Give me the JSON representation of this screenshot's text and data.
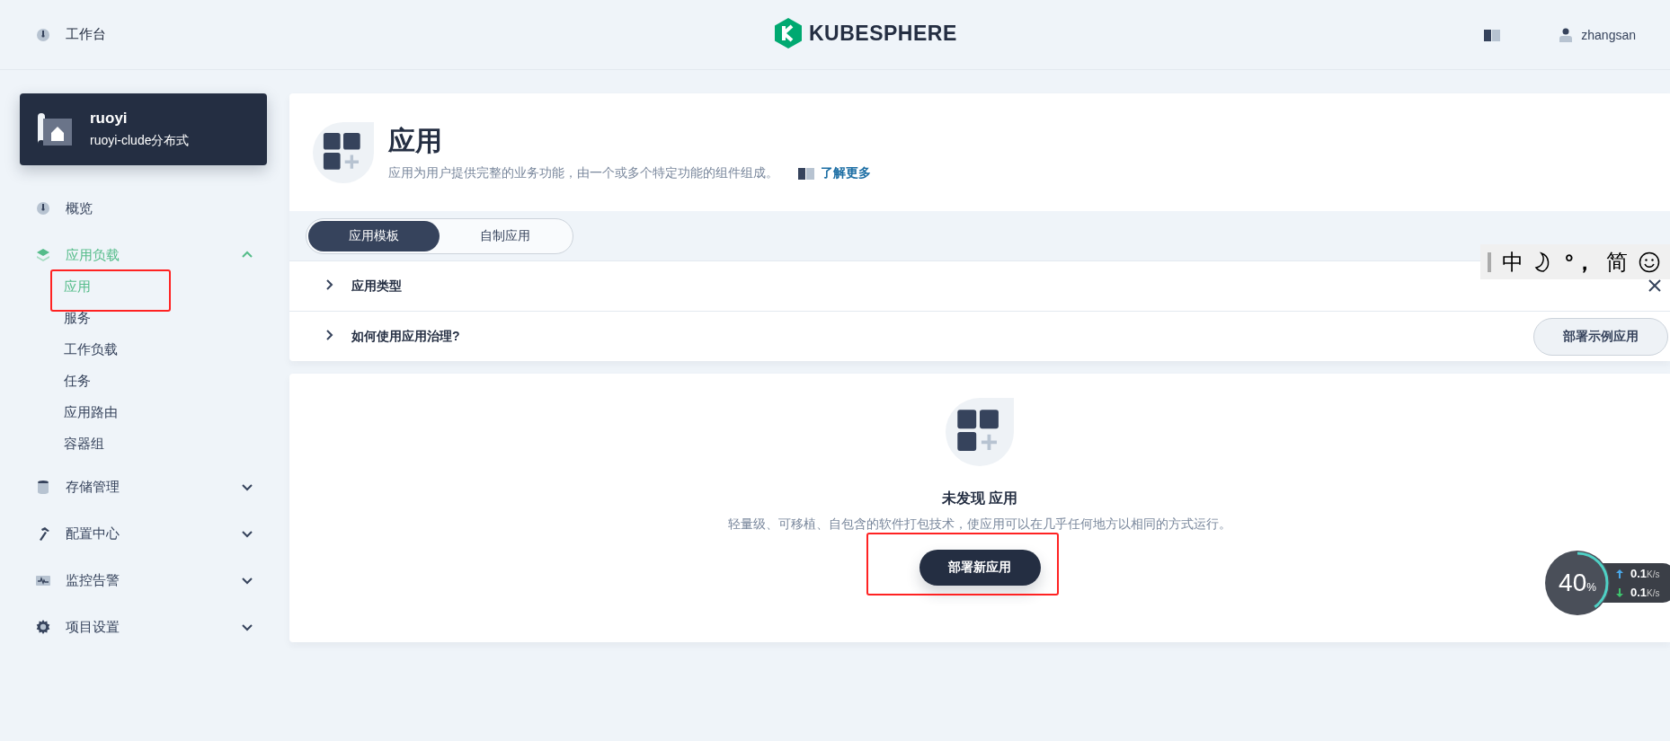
{
  "header": {
    "workbench": "工作台",
    "logo": "KUBESPHERE",
    "user": "zhangsan"
  },
  "project": {
    "name": "ruoyi",
    "description": "ruoyi-clude分布式"
  },
  "nav": [
    {
      "label": "概览",
      "kind": "link",
      "selected": false
    },
    {
      "label": "应用负载",
      "kind": "group",
      "selected": true,
      "expanded": true,
      "children": [
        {
          "label": "应用",
          "selected": true,
          "highlighted": true
        },
        {
          "label": "服务",
          "selected": false,
          "highlighted": false
        },
        {
          "label": "工作负载",
          "selected": false,
          "highlighted": false
        },
        {
          "label": "任务",
          "selected": false,
          "highlighted": false
        },
        {
          "label": "应用路由",
          "selected": false,
          "highlighted": false
        },
        {
          "label": "容器组",
          "selected": false,
          "highlighted": false
        }
      ]
    },
    {
      "label": "存储管理",
      "kind": "group",
      "selected": false,
      "expanded": false
    },
    {
      "label": "配置中心",
      "kind": "group",
      "selected": false,
      "expanded": false
    },
    {
      "label": "监控告警",
      "kind": "group",
      "selected": false,
      "expanded": false
    },
    {
      "label": "项目设置",
      "kind": "group",
      "selected": false,
      "expanded": false
    }
  ],
  "page": {
    "title": "应用",
    "description": "应用为用户提供完整的业务功能，由一个或多个特定功能的组件组成。",
    "link": "了解更多"
  },
  "tabs": [
    {
      "label": "应用模板",
      "selected": true
    },
    {
      "label": "自制应用",
      "selected": false
    }
  ],
  "sections": [
    {
      "title": "应用类型",
      "expanded": false
    },
    {
      "title": "如何使用应用治理?",
      "expanded": false,
      "action": "部署示例应用"
    }
  ],
  "empty": {
    "title": "未发现 应用",
    "description": "轻量级、可移植、自包含的软件打包技术，使应用可以在几乎任何地方以相同的方式运行。",
    "button": "部署新应用",
    "highlighted": true
  },
  "ime": {
    "mode": "中",
    "punctuation": "°，",
    "script": "简"
  },
  "speed": {
    "level": 0.4,
    "percent": "40",
    "percent_unit": "%",
    "upload": "0.1",
    "upload_unit": "K/s",
    "download": "0.1",
    "download_unit": "K/s"
  }
}
